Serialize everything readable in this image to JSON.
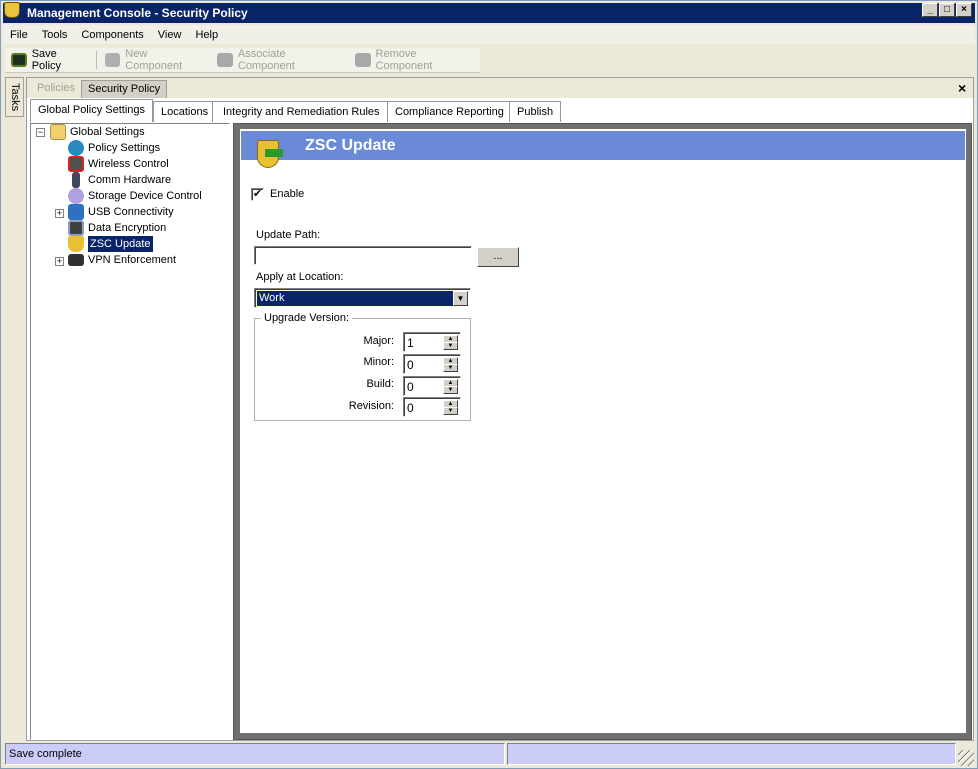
{
  "window": {
    "title": "Management Console - Security Policy"
  },
  "menu": [
    "File",
    "Tools",
    "Components",
    "View",
    "Help"
  ],
  "toolbar": {
    "save": "Save Policy",
    "new_component": "New Component",
    "associate_component": "Associate Component",
    "remove_component": "Remove Component"
  },
  "tasks_label": "Tasks",
  "doc_tabs": {
    "policies": "Policies",
    "security_policy": "Security Policy"
  },
  "sub_tabs": [
    "Global Policy Settings",
    "Locations",
    "Integrity and Remediation Rules",
    "Compliance Reporting",
    "Publish"
  ],
  "tree": {
    "root": "Global Settings",
    "items": [
      "Policy Settings",
      "Wireless Control",
      "Comm Hardware",
      "Storage Device Control",
      "USB Connectivity",
      "Data Encryption",
      "ZSC Update",
      "VPN Enforcement"
    ],
    "selected": "ZSC Update"
  },
  "panel": {
    "title": "ZSC Update",
    "enable_label": "Enable",
    "enable_checked": true,
    "update_path_label": "Update Path:",
    "update_path_value": "",
    "browse_label": "...",
    "apply_location_label": "Apply at Location:",
    "apply_location_value": "Work",
    "upgrade_version_label": "Upgrade Version:",
    "major_label": "Major:",
    "major": "1",
    "minor_label": "Minor:",
    "minor": "0",
    "build_label": "Build:",
    "build": "0",
    "revision_label": "Revision:",
    "revision": "0"
  },
  "status": {
    "text": "Save complete"
  }
}
